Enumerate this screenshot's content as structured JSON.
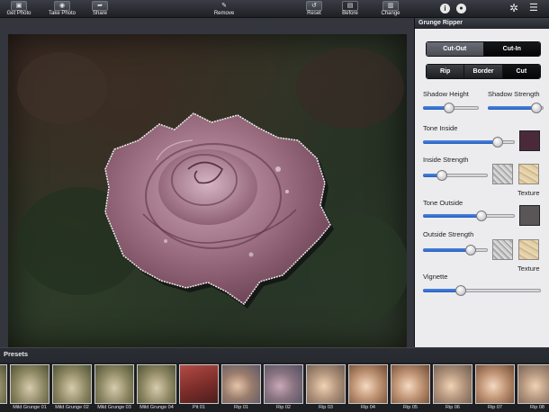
{
  "toolbar": {
    "get_photo": "Get Photo",
    "take_photo": "Take Photo",
    "share": "Share",
    "remove": "Remove",
    "reset": "Reset",
    "before": "Before",
    "change": "Change"
  },
  "panel": {
    "title": "Grunge Ripper",
    "mode_segments": [
      "Cut-Out",
      "Cut-In"
    ],
    "style_segments": [
      "Rip",
      "Border",
      "Cut"
    ],
    "shadow_height": {
      "label": "Shadow Height",
      "value": 0.45
    },
    "shadow_strength": {
      "label": "Shadow Strength",
      "value": 0.95
    },
    "tone_inside": {
      "label": "Tone Inside",
      "value": 0.85,
      "color": "#4a2a3a"
    },
    "inside_strength": {
      "label": "Inside Strength",
      "value": 0.25,
      "texture_label": "Texture"
    },
    "tone_outside": {
      "label": "Tone Outside",
      "value": 0.65,
      "color": "#5a5658"
    },
    "outside_strength": {
      "label": "Outside Strength",
      "value": 0.78,
      "texture_label": "Texture"
    },
    "vignette": {
      "label": "Vignette",
      "value": 0.3
    }
  },
  "presets": {
    "title": "Presets",
    "items": [
      {
        "label": "",
        "style": "t-grunge"
      },
      {
        "label": "Mild Grunge 01",
        "style": "t-grunge"
      },
      {
        "label": "Mild Grunge 02",
        "style": "t-grunge"
      },
      {
        "label": "Mild Grunge 03",
        "style": "t-grunge"
      },
      {
        "label": "Mild Grunge 04",
        "style": "t-grunge"
      },
      {
        "label": "Pit 01",
        "style": "t-pit"
      },
      {
        "label": "Rip 01",
        "style": "t-rip"
      },
      {
        "label": "Rip 02",
        "style": "t-rip2"
      },
      {
        "label": "Rip 03",
        "style": "t-rip3"
      },
      {
        "label": "Rip 04",
        "style": "t-rip4"
      },
      {
        "label": "Rip 05",
        "style": "t-rip4"
      },
      {
        "label": "Rip 06",
        "style": "t-rip3"
      },
      {
        "label": "Rip 07",
        "style": "t-rip4"
      },
      {
        "label": "Rip 08",
        "style": "t-rip3"
      }
    ]
  }
}
